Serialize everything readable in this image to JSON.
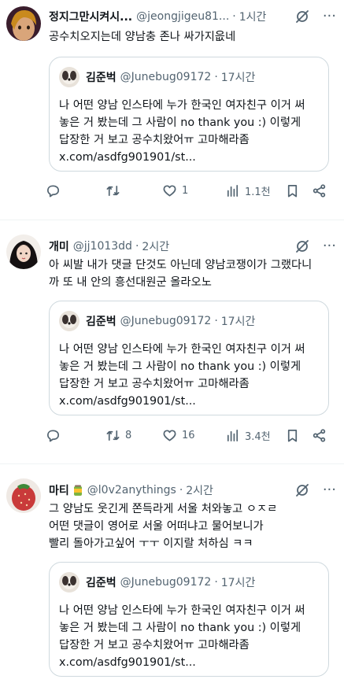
{
  "tweets": [
    {
      "name": "정지그만시켜시...",
      "handle": "@jeongjigeu81...",
      "time": "1시간",
      "text": "공수치오지는데 양남충 존나 싸가지읎네",
      "reply_count": "",
      "retweet_count": "",
      "like_count": "1",
      "view_count": "1.1천"
    },
    {
      "name": "개미",
      "handle": "@jj1013dd",
      "time": "2시간",
      "text": "아 씨발 내가 댓글 단것도 아닌데 양남코쟁이가 그랬다니\n까 또 내 안의 흥선대원군 올라오노",
      "reply_count": "",
      "retweet_count": "8",
      "like_count": "16",
      "view_count": "3.4천"
    },
    {
      "name": "마티",
      "handle": "@l0v2anythings",
      "time": "2시간",
      "text": "그 양남도 웃긴게 쫀득라게 서울 처와놓고 ㅇㅈㄹ\n어떤 댓글이 영어로 서울 어떠냐고 물어보니가\n빨리 돌아가고싶어 ㅜㅜ 이지랄 처하심 ㅋㅋ"
    }
  ],
  "quote": {
    "name": "김준벅",
    "handle": "@Junebug09172",
    "time": "17시간",
    "text": "나 어떤 양남 인스타에 누가 한국인 여자친구 이거 써\n놓은 거 봤는데 그 사람이 no thank you :) 이렇게\n답장한 거 보고 공수치왔어ㅠ 고마해라좀\nx.com/asdfg901901/st..."
  },
  "separator": "·",
  "more_glyph": "···",
  "colors": {
    "text": "#0f1419",
    "secondary": "#536471",
    "border": "#cfd9de"
  },
  "icons": [
    "grok-icon",
    "more-icon",
    "reply-icon",
    "retweet-icon",
    "like-icon",
    "views-icon",
    "bookmark-icon",
    "share-icon"
  ]
}
